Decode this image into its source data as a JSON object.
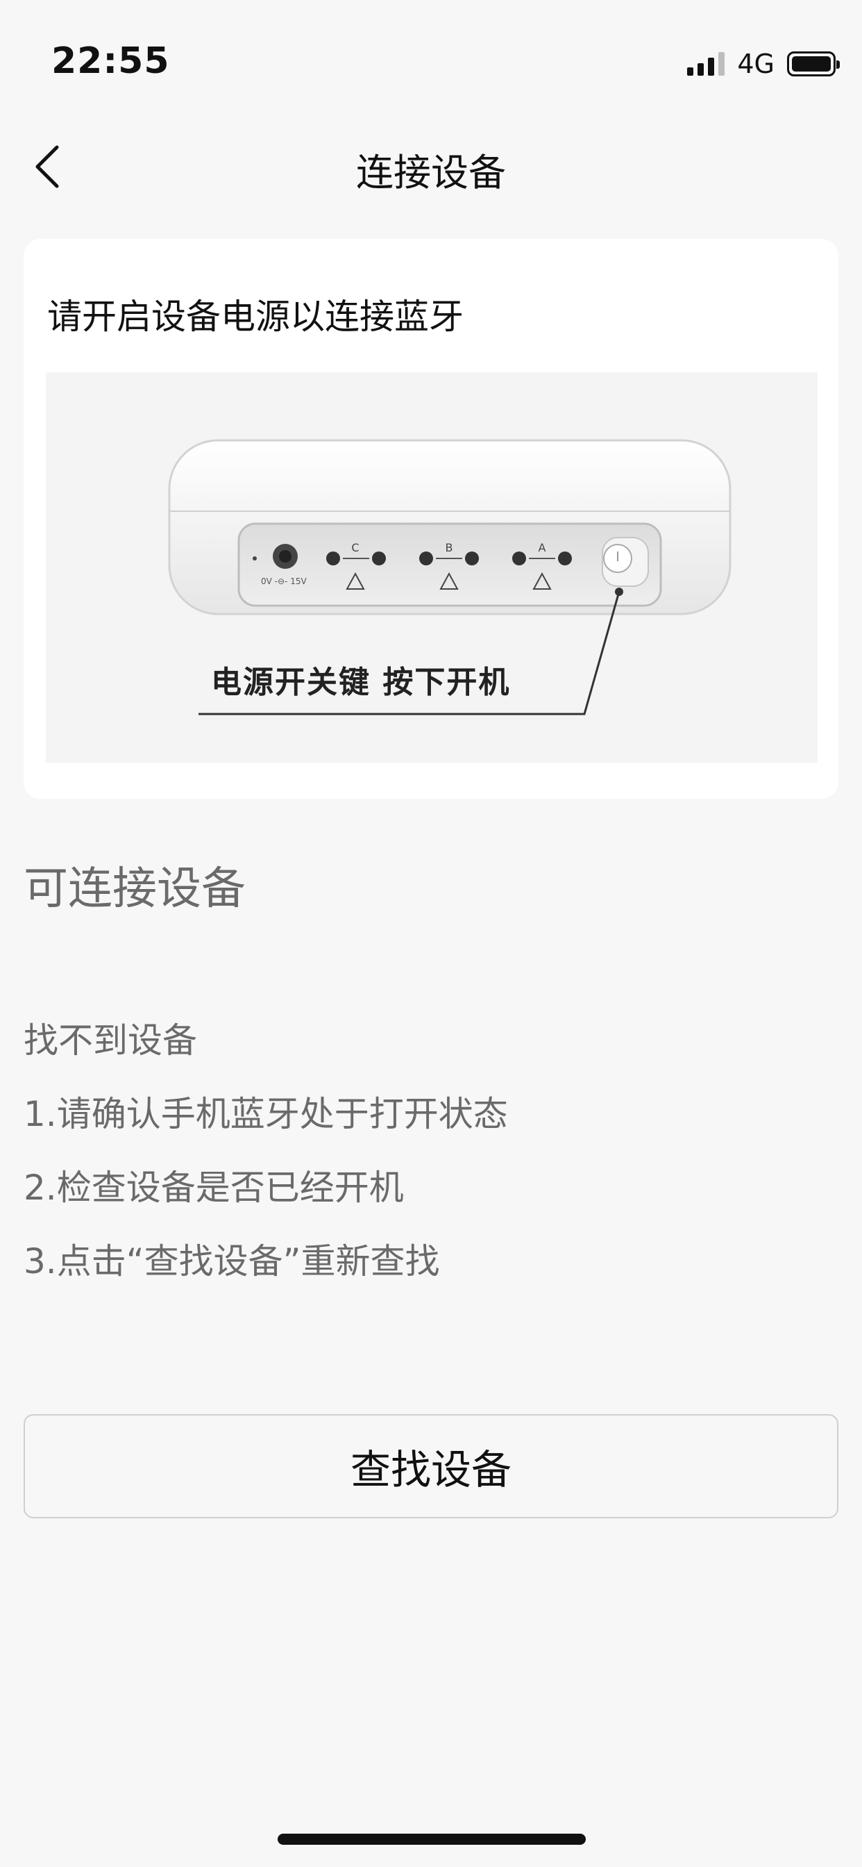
{
  "status_bar": {
    "time": "22:55",
    "network": "4G",
    "icons": [
      "signal-icon",
      "battery-icon"
    ]
  },
  "nav": {
    "title": "连接设备",
    "back_icon": "chevron-left-icon"
  },
  "card": {
    "instruction": "请开启设备电源以连接蓝牙",
    "callout": "电源开关键  按下开机",
    "port_labels": [
      "C",
      "B",
      "A"
    ],
    "power_label": "0V -⊖- 15V"
  },
  "section": {
    "title": "可连接设备"
  },
  "help": {
    "lines": [
      "找不到设备",
      "1.请确认手机蓝牙处于打开状态",
      "2.检查设备是否已经开机",
      "3.点击“查找设备”重新查找"
    ]
  },
  "actions": {
    "search_label": "查找设备"
  }
}
